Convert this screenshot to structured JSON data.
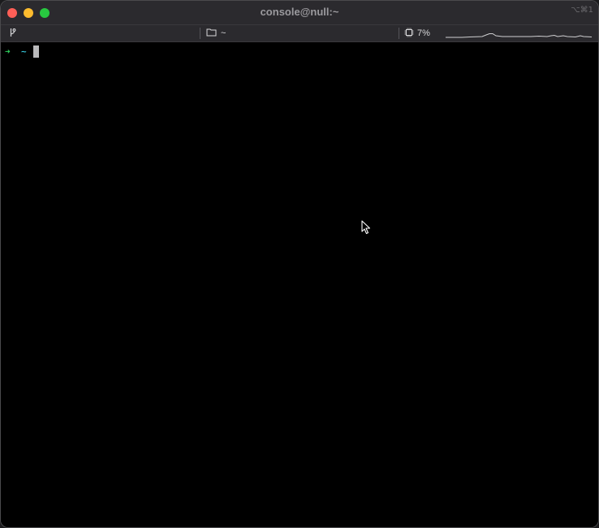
{
  "window": {
    "title": "console@null:~",
    "shortcut": "⌥⌘1",
    "controls": {
      "close_color": "#ff5f57",
      "minimize_color": "#febc2e",
      "maximize_color": "#28c840"
    }
  },
  "statusbar": {
    "git": {
      "icon": "git-branch-icon",
      "label": ""
    },
    "directory": {
      "icon": "folder-icon",
      "label": "~"
    },
    "cpu": {
      "icon": "cpu-chip-icon",
      "label": "7%"
    },
    "cpu_history": {
      "icon": "activity-graph-icon"
    }
  },
  "terminal": {
    "prompt_symbol": "➜",
    "cwd": "~",
    "input": "",
    "colors": {
      "arrow": "#2ed15e",
      "cwd": "#34c3d6",
      "background": "#000000"
    }
  },
  "pointer": {
    "icon": "mouse-pointer-icon"
  }
}
